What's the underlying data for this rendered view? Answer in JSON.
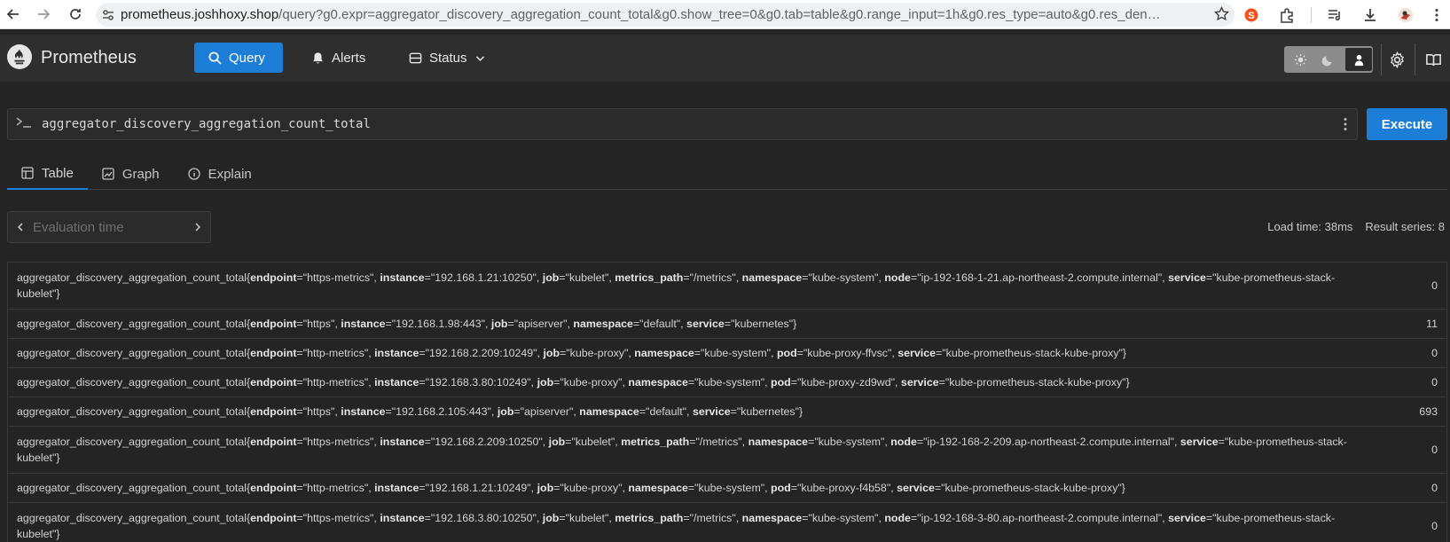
{
  "browser": {
    "url_host": "prometheus.joshhoxy.shop",
    "url_rest": "/query?g0.expr=aggregator_discovery_aggregation_count_total&g0.show_tree=0&g0.tab=table&g0.range_input=1h&g0.res_type=auto&g0.res_density=..."
  },
  "header": {
    "brand": "Prometheus",
    "nav": [
      {
        "label": "Query",
        "icon": "search-icon"
      },
      {
        "label": "Alerts",
        "icon": "bell-icon"
      },
      {
        "label": "Status",
        "icon": "database-icon"
      }
    ]
  },
  "query": {
    "expr": "aggregator_discovery_aggregation_count_total",
    "execute_label": "Execute"
  },
  "tabs": [
    {
      "label": "Table",
      "icon": "table-icon",
      "active": true
    },
    {
      "label": "Graph",
      "icon": "graph-icon",
      "active": false
    },
    {
      "label": "Explain",
      "icon": "info-icon",
      "active": false
    }
  ],
  "eval": {
    "placeholder": "Evaluation time"
  },
  "stats": {
    "load_time": "Load time: 38ms",
    "result_series": "Result series: 8"
  },
  "metric_name": "aggregator_discovery_aggregation_count_total",
  "results": [
    {
      "labels": [
        [
          "endpoint",
          "https-metrics"
        ],
        [
          "instance",
          "192.168.1.21:10250"
        ],
        [
          "job",
          "kubelet"
        ],
        [
          "metrics_path",
          "/metrics"
        ],
        [
          "namespace",
          "kube-system"
        ],
        [
          "node",
          "ip-192-168-1-21.ap-northeast-2.compute.internal"
        ],
        [
          "service",
          "kube-prometheus-stack-kubelet"
        ]
      ],
      "value": "0"
    },
    {
      "labels": [
        [
          "endpoint",
          "https"
        ],
        [
          "instance",
          "192.168.1.98:443"
        ],
        [
          "job",
          "apiserver"
        ],
        [
          "namespace",
          "default"
        ],
        [
          "service",
          "kubernetes"
        ]
      ],
      "value": "11"
    },
    {
      "labels": [
        [
          "endpoint",
          "http-metrics"
        ],
        [
          "instance",
          "192.168.2.209:10249"
        ],
        [
          "job",
          "kube-proxy"
        ],
        [
          "namespace",
          "kube-system"
        ],
        [
          "pod",
          "kube-proxy-ffvsc"
        ],
        [
          "service",
          "kube-prometheus-stack-kube-proxy"
        ]
      ],
      "value": "0"
    },
    {
      "labels": [
        [
          "endpoint",
          "http-metrics"
        ],
        [
          "instance",
          "192.168.3.80:10249"
        ],
        [
          "job",
          "kube-proxy"
        ],
        [
          "namespace",
          "kube-system"
        ],
        [
          "pod",
          "kube-proxy-zd9wd"
        ],
        [
          "service",
          "kube-prometheus-stack-kube-proxy"
        ]
      ],
      "value": "0"
    },
    {
      "labels": [
        [
          "endpoint",
          "https"
        ],
        [
          "instance",
          "192.168.2.105:443"
        ],
        [
          "job",
          "apiserver"
        ],
        [
          "namespace",
          "default"
        ],
        [
          "service",
          "kubernetes"
        ]
      ],
      "value": "693"
    },
    {
      "labels": [
        [
          "endpoint",
          "https-metrics"
        ],
        [
          "instance",
          "192.168.2.209:10250"
        ],
        [
          "job",
          "kubelet"
        ],
        [
          "metrics_path",
          "/metrics"
        ],
        [
          "namespace",
          "kube-system"
        ],
        [
          "node",
          "ip-192-168-2-209.ap-northeast-2.compute.internal"
        ],
        [
          "service",
          "kube-prometheus-stack-kubelet"
        ]
      ],
      "value": "0"
    },
    {
      "labels": [
        [
          "endpoint",
          "http-metrics"
        ],
        [
          "instance",
          "192.168.1.21:10249"
        ],
        [
          "job",
          "kube-proxy"
        ],
        [
          "namespace",
          "kube-system"
        ],
        [
          "pod",
          "kube-proxy-f4b58"
        ],
        [
          "service",
          "kube-prometheus-stack-kube-proxy"
        ]
      ],
      "value": "0"
    },
    {
      "labels": [
        [
          "endpoint",
          "https-metrics"
        ],
        [
          "instance",
          "192.168.3.80:10250"
        ],
        [
          "job",
          "kubelet"
        ],
        [
          "metrics_path",
          "/metrics"
        ],
        [
          "namespace",
          "kube-system"
        ],
        [
          "node",
          "ip-192-168-3-80.ap-northeast-2.compute.internal"
        ],
        [
          "service",
          "kube-prometheus-stack-kubelet"
        ]
      ],
      "value": "0"
    }
  ]
}
